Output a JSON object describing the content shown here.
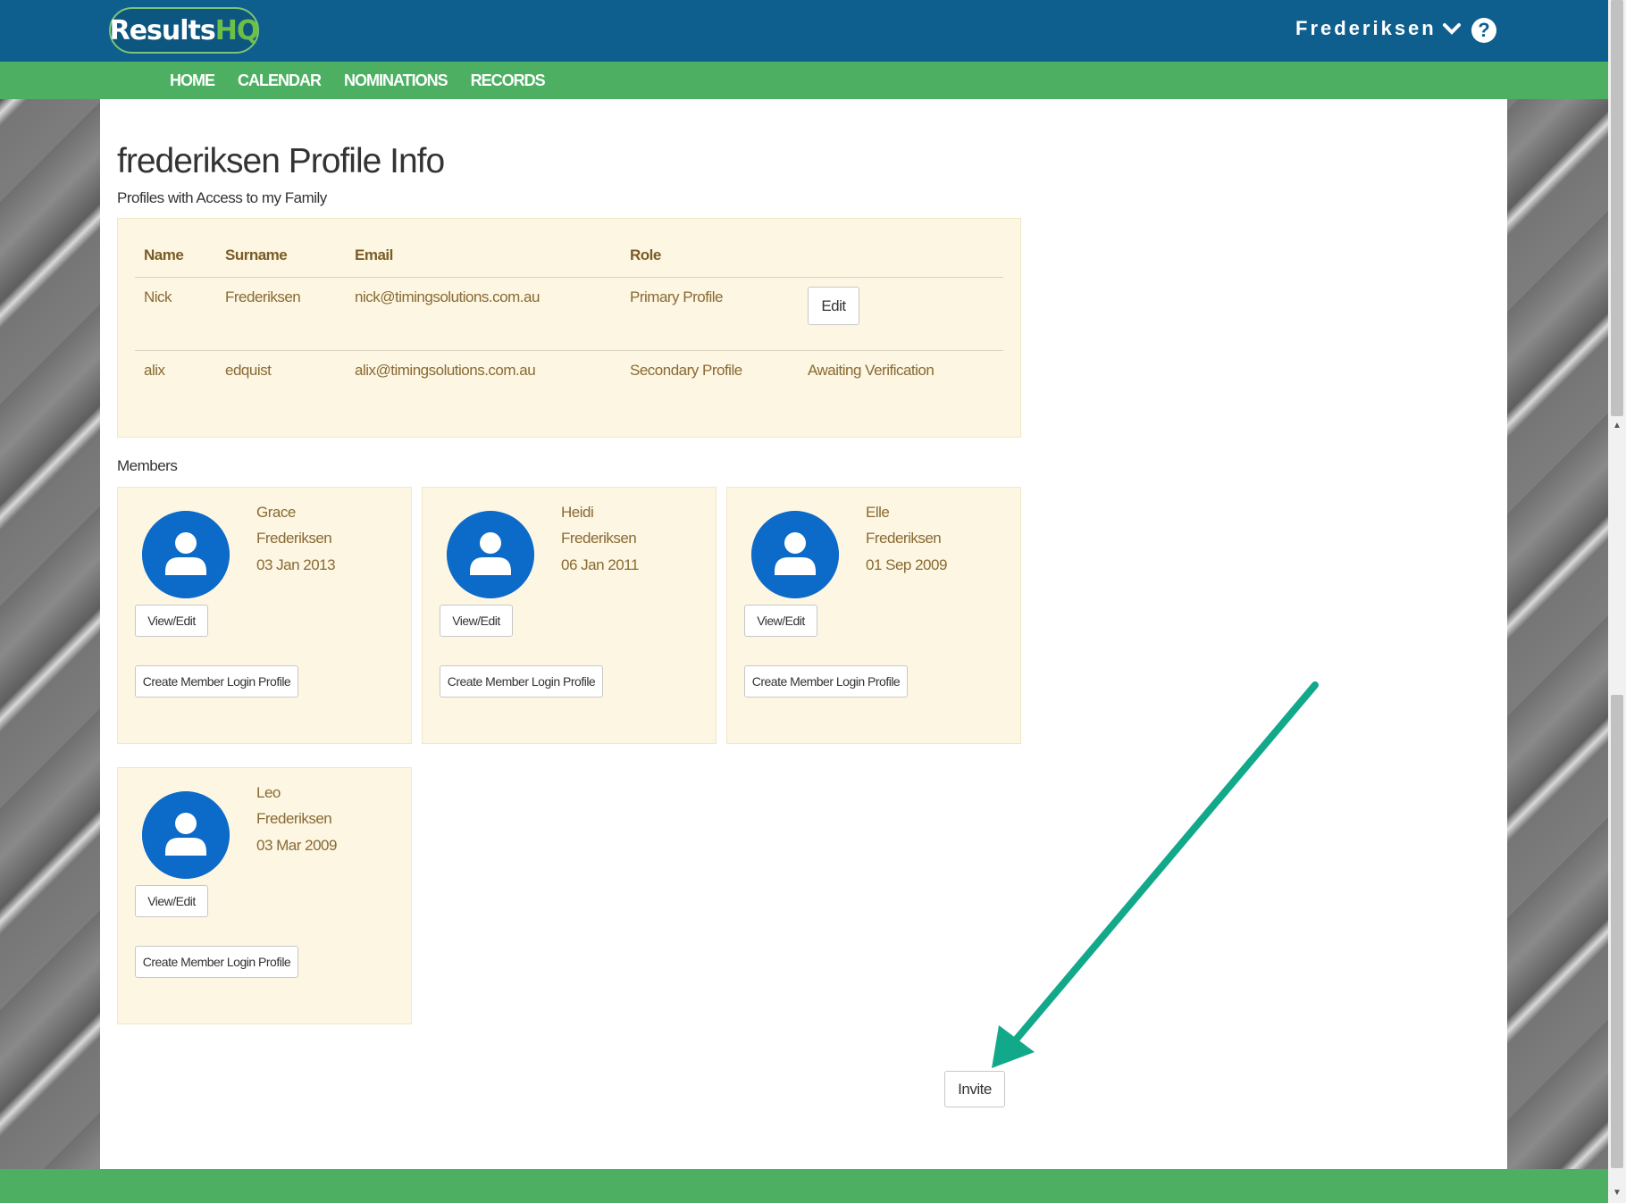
{
  "header": {
    "logo_main": "Results",
    "logo_accent": "HQ",
    "user_name": "Frederiksen",
    "help_symbol": "?",
    "colors": {
      "top": "#0f5f8e",
      "nav": "#4caf61",
      "accent": "#6cc04a"
    }
  },
  "nav": {
    "items": [
      "HOME",
      "CALENDAR",
      "NOMINATIONS",
      "RECORDS"
    ]
  },
  "page": {
    "title": "frederiksen Profile Info",
    "access_heading": "Profiles with Access to my Family",
    "members_heading": "Members",
    "invite_label": "Invite"
  },
  "access_table": {
    "headers": [
      "Name",
      "Surname",
      "Email",
      "Role"
    ],
    "rows": [
      {
        "name": "Nick",
        "surname": "Frederiksen",
        "email": "nick@timingsolutions.com.au",
        "role": "Primary Profile",
        "action": "Edit"
      },
      {
        "name": "alix",
        "surname": "edquist",
        "email": "alix@timingsolutions.com.au",
        "role": "Secondary Profile",
        "action": "Awaiting Verification"
      }
    ]
  },
  "members": [
    {
      "first": "Grace",
      "last": "Frederiksen",
      "dob": "03 Jan 2013",
      "view_label": "View/Edit",
      "create_label": "Create Member Login Profile"
    },
    {
      "first": "Heidi",
      "last": "Frederiksen",
      "dob": "06 Jan 2011",
      "view_label": "View/Edit",
      "create_label": "Create Member Login Profile"
    },
    {
      "first": "Elle",
      "last": "Frederiksen",
      "dob": "01 Sep 2009",
      "view_label": "View/Edit",
      "create_label": "Create Member Login Profile"
    },
    {
      "first": "Leo",
      "last": "Frederiksen",
      "dob": "03 Mar 2009",
      "view_label": "View/Edit",
      "create_label": "Create Member Login Profile"
    }
  ],
  "icons": {
    "user_menu": "chevron-down-icon",
    "help": "help-icon",
    "member_avatar": "user-avatar-icon",
    "annotation": "arrow-annotation-icon"
  }
}
